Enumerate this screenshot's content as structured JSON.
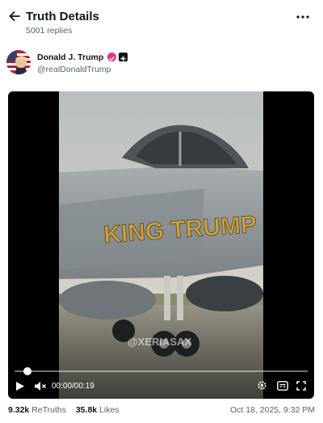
{
  "header": {
    "title": "Truth Details",
    "replies": "5001 replies"
  },
  "author": {
    "name": "Donald J. Trump",
    "handle": "@realDonaldTrump",
    "verified_color": "#e0338a"
  },
  "media": {
    "overlay_text": "KING TRUMP",
    "watermark": "@XERIASAX",
    "time": "00:00/00:19",
    "progress": 0.0
  },
  "stats": {
    "retruths_count": "9.32k",
    "retruths_label": "ReTruths",
    "likes_count": "35.8k",
    "likes_label": "Likes",
    "date": "Oct 18, 2025, 9:32 PM"
  },
  "icons": {
    "back": "arrow-left-icon",
    "more": "more-horizontal-icon",
    "play": "play-icon",
    "volume": "volume-muted-icon",
    "settings": "gear-icon",
    "captions": "captions-icon",
    "fullscreen": "fullscreen-icon"
  }
}
